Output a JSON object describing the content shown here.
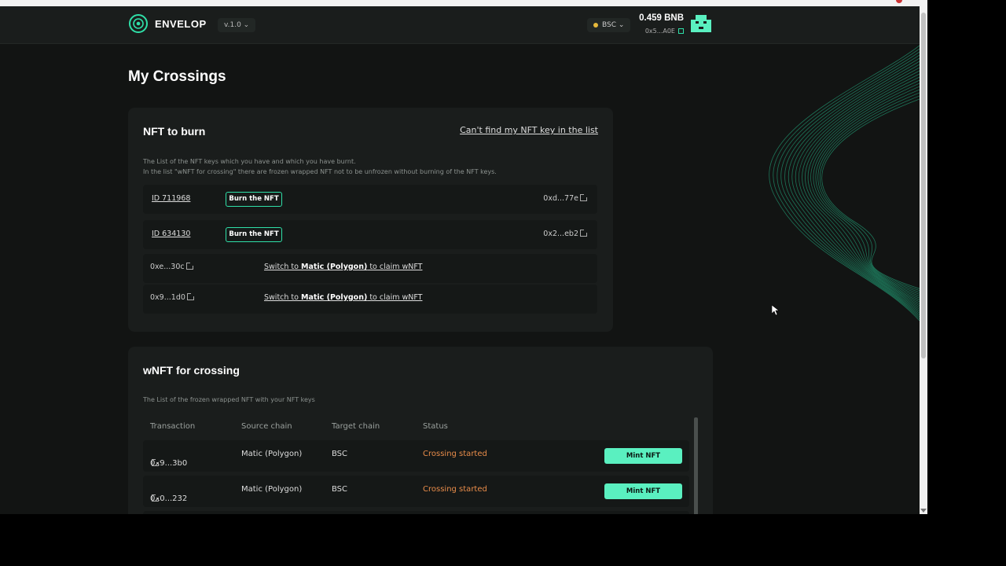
{
  "header": {
    "logo_text": "ENVELOP",
    "version": "v.1.0 ⌄",
    "network": "BSC ⌄",
    "balance": "0.459 BNB",
    "address": "0x5...A0E"
  },
  "page": {
    "title": "My Crossings"
  },
  "burn_card": {
    "title": "NFT to burn",
    "link": "Can't find my NFT key in the list",
    "desc_line1": "The List of the NFT keys which you have and which you have burnt.",
    "desc_line2": "In the list \"wNFT for crossing\" there are frozen wrapped NFT not to be unfrozen without burning of the NFT keys.",
    "burn_rows": [
      {
        "id": "ID 711968",
        "button": "Burn the NFT",
        "hash": "0xd...77e"
      },
      {
        "id": "ID 634130",
        "button": "Burn the NFT",
        "hash": "0x2...eb2"
      }
    ],
    "switch_rows": [
      {
        "hash": "0xe...30c",
        "prefix": "Switch to ",
        "chain": "Matic (Polygon)",
        "suffix": " to claim wNFT"
      },
      {
        "hash": "0x9...1d0",
        "prefix": "Switch to ",
        "chain": "Matic (Polygon)",
        "suffix": " to claim wNFT"
      }
    ]
  },
  "crossing_card": {
    "title": "wNFT for crossing",
    "desc": "The List of the frozen wrapped NFT with your NFT keys",
    "columns": [
      "Transaction",
      "Source chain",
      "Target chain",
      "Status"
    ],
    "rows": [
      {
        "tx": "0x9...3b0",
        "source": "Matic (Polygon)",
        "target": "BSC",
        "status": "Crossing started",
        "button": "Mint NFT"
      },
      {
        "tx": "0x0...232",
        "source": "Matic (Polygon)",
        "target": "BSC",
        "status": "Crossing started",
        "button": "Mint NFT"
      }
    ]
  },
  "colors": {
    "accent": "#5af0c0",
    "status_orange": "#e88c4a",
    "background": "#121413",
    "card": "#1a1d1c"
  }
}
